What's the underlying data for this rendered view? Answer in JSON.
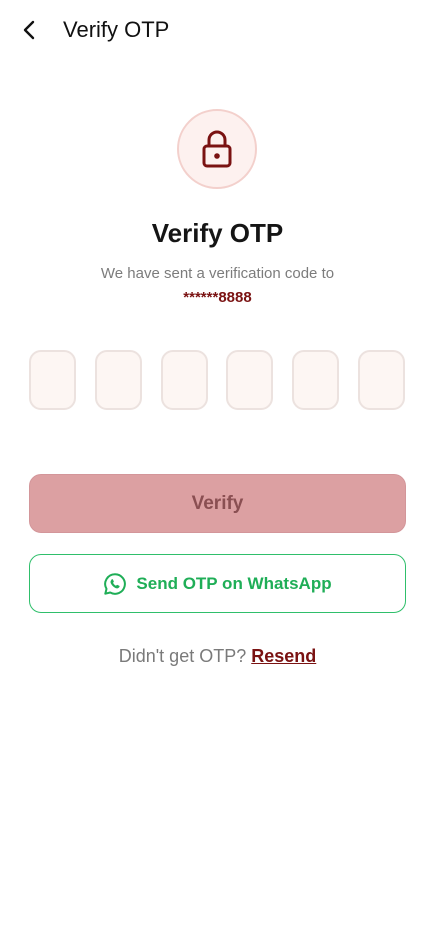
{
  "header": {
    "title": "Verify OTP",
    "back_icon": "chevron-left-icon"
  },
  "hero": {
    "icon": "lock-icon",
    "title": "Verify OTP",
    "subtitle": "We have sent a verification code to",
    "phone_masked": "******8888"
  },
  "otp": {
    "length": 6,
    "digits": [
      "",
      "",
      "",
      "",
      "",
      ""
    ]
  },
  "actions": {
    "verify_label": "Verify",
    "whatsapp_label": "Send OTP on WhatsApp",
    "whatsapp_icon": "whatsapp-icon"
  },
  "resend": {
    "prompt": "Didn't get OTP?",
    "link_label": "Resend"
  },
  "colors": {
    "brand_maroon": "#7a1212",
    "verify_disabled_bg": "#dca0a2",
    "whatsapp_green": "#1fae57",
    "lock_circle_bg": "#fdf1ef",
    "otp_box_bg": "#fdf6f3"
  }
}
